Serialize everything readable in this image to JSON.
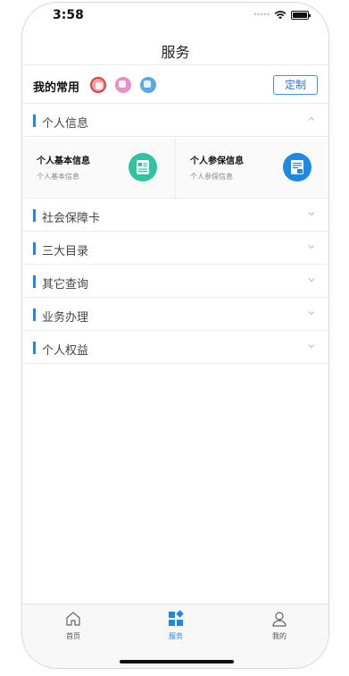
{
  "status": {
    "time": "3:58"
  },
  "nav": {
    "title": "服务"
  },
  "favorites": {
    "label": "我的常用",
    "customize_label": "定制"
  },
  "sections": [
    {
      "title": "个人信息",
      "expanded": true
    },
    {
      "title": "社会保障卡",
      "expanded": false
    },
    {
      "title": "三大目录",
      "expanded": false
    },
    {
      "title": "其它查询",
      "expanded": false
    },
    {
      "title": "业务办理",
      "expanded": false
    },
    {
      "title": "个人权益",
      "expanded": false
    }
  ],
  "personal_info": {
    "cards": [
      {
        "title": "个人基本信息",
        "subtitle": "个人基本信息",
        "icon": "id-card-icon",
        "color": "#2ec4a0"
      },
      {
        "title": "个人参保信息",
        "subtitle": "个人参保信息",
        "icon": "insurance-doc-icon",
        "color": "#1e88e5"
      }
    ]
  },
  "tabbar": {
    "items": [
      {
        "label": "首页",
        "icon": "home-icon"
      },
      {
        "label": "服务",
        "icon": "grid-icon",
        "active": true
      },
      {
        "label": "我的",
        "icon": "user-icon"
      }
    ]
  },
  "colors": {
    "accent": "#1e88e5",
    "teal": "#2ec4a0",
    "divider": "#ececec"
  }
}
